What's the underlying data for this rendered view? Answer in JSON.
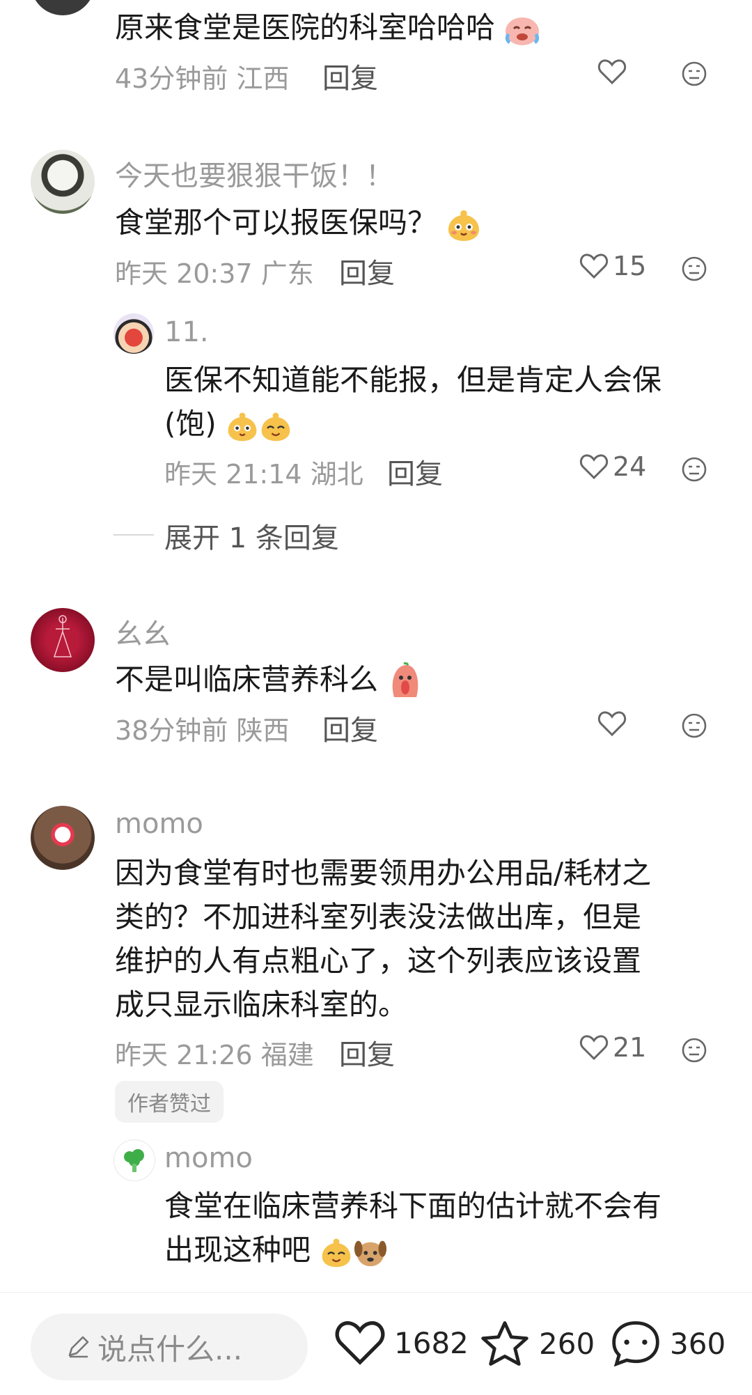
{
  "comments": [
    {
      "text": "原来食堂是医院的科室哈哈哈",
      "time": "43分钟前",
      "location": "江西",
      "reply_label": "回复",
      "likes": ""
    },
    {
      "username": "今天也要狠狠干饭！！",
      "text": "食堂那个可以报医保吗？",
      "time": "昨天 20:37",
      "location": "广东",
      "reply_label": "回复",
      "likes": "15",
      "replies": [
        {
          "username": "11.",
          "text_line1": "医保不知道能不能报，但是肯定人会保",
          "text_line2": "(饱)",
          "time": "昨天 21:14",
          "location": "湖北",
          "reply_label": "回复",
          "likes": "24"
        }
      ],
      "expand_label": "展开 1 条回复"
    },
    {
      "username": "幺幺",
      "text": "不是叫临床营养科么",
      "time": "38分钟前",
      "location": "陕西",
      "reply_label": "回复",
      "likes": ""
    },
    {
      "username": "momo",
      "text_lines": [
        "因为食堂有时也需要领用办公用品/耗材之",
        "类的？不加进科室列表没法做出库，但是",
        "维护的人有点粗心了，这个列表应该设置",
        "成只显示临床科室的。"
      ],
      "time": "昨天 21:26",
      "location": "福建",
      "reply_label": "回复",
      "likes": "21",
      "author_tag": "作者赞过",
      "replies": [
        {
          "username": "momo",
          "text_line1": "食堂在临床营养科下面的估计就不会有",
          "text_line2": "出现这种吧"
        }
      ]
    }
  ],
  "bottom_bar": {
    "input_placeholder": "说点什么...",
    "likes": "1682",
    "stars": "260",
    "comments": "360"
  }
}
